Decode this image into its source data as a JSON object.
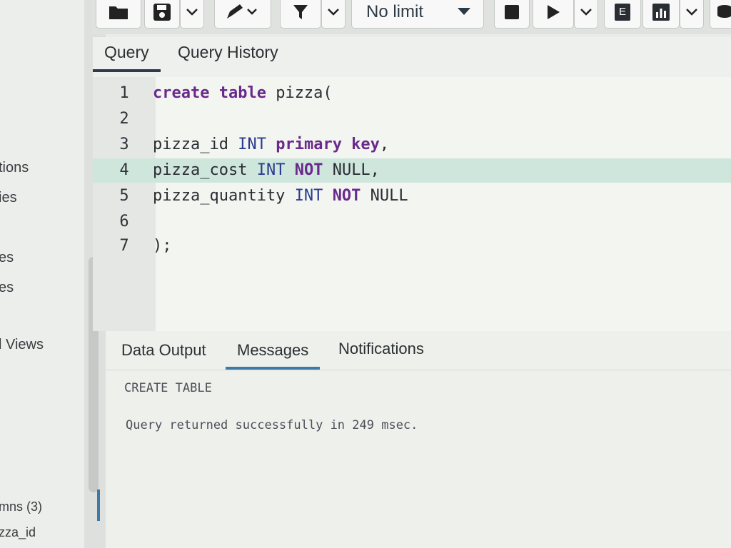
{
  "toolbar": {
    "limit_label": "No limit",
    "explain_label": "E",
    "icons": [
      "folder-icon",
      "save-icon",
      "chevron-down-icon",
      "edit-pen-icon",
      "filter-icon",
      "stop-icon",
      "play-icon",
      "explain-icon",
      "analyze-chart-icon",
      "macros-icon"
    ]
  },
  "query_tabs": [
    {
      "label": "Query",
      "active": true
    },
    {
      "label": "Query History",
      "active": false
    }
  ],
  "editor": {
    "lines": [
      {
        "n": "1",
        "kw1": "create table",
        "t1": " pizza(",
        "ty": "",
        "t2": "",
        "kw2": "",
        "t3": ""
      },
      {
        "n": "2",
        "kw1": "",
        "t1": "",
        "ty": "",
        "t2": "",
        "kw2": "",
        "t3": ""
      },
      {
        "n": "3",
        "kw1": "",
        "t1": "pizza_id ",
        "ty": "INT",
        "t2": " ",
        "kw2": "primary key",
        "t3": ","
      },
      {
        "n": "4",
        "kw1": "",
        "t1": "pizza_cost ",
        "ty": "INT",
        "t2": " ",
        "kw2": "NOT",
        "t3": " NULL,"
      },
      {
        "n": "5",
        "kw1": "",
        "t1": "pizza_quantity ",
        "ty": "INT",
        "t2": " ",
        "kw2": "NOT",
        "t3": " NULL"
      },
      {
        "n": "6",
        "kw1": "",
        "t1": "",
        "ty": "",
        "t2": "",
        "kw2": "",
        "t3": ""
      },
      {
        "n": "7",
        "kw1": "",
        "t1": ");",
        "ty": "",
        "t2": "",
        "kw2": "",
        "t3": ""
      }
    ],
    "highlighted_line": 4
  },
  "result_tabs": [
    {
      "label": "Data Output",
      "active": false
    },
    {
      "label": "Messages",
      "active": true
    },
    {
      "label": "Notifications",
      "active": false
    }
  ],
  "messages": {
    "line1": "CREATE TABLE",
    "line2": "Query returned successfully in 249 msec."
  },
  "sidebar": {
    "items": [
      {
        "label": "tions"
      },
      {
        "label": "ies"
      },
      {
        "label": "es"
      },
      {
        "label": "es"
      },
      {
        "label": "l Views"
      },
      {
        "label": "mns (3)"
      },
      {
        "label": "zza_id"
      }
    ]
  },
  "colors": {
    "keyword": "#6a2a8c",
    "type": "#2b3b8f",
    "line_highlight": "#cfe6dd",
    "active_tab_underline": "#3d7aa8"
  }
}
